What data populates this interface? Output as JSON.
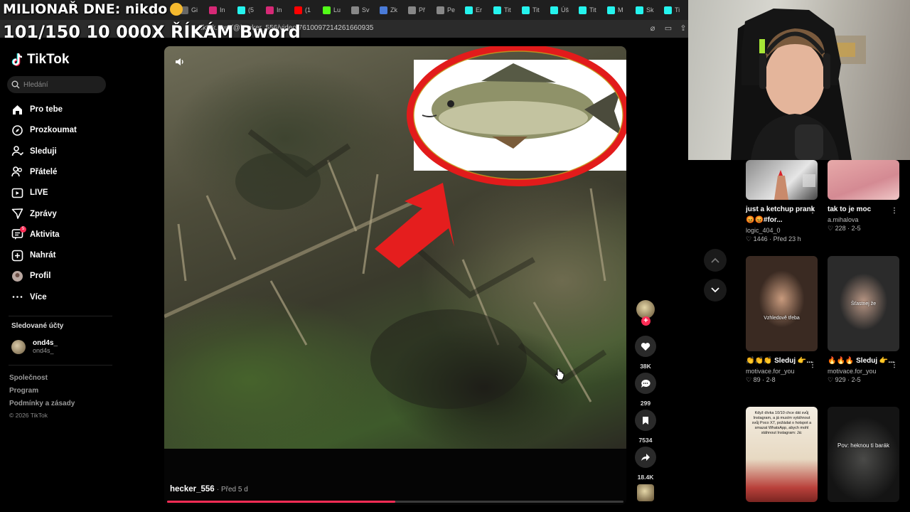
{
  "stream_overlay": {
    "line1": "MILIONAŘ DNE: nikdo",
    "line2": "101/150 10 000X ŘÍKÁM Bword"
  },
  "browser": {
    "tabs": [
      {
        "label": "Gi",
        "color": "#666666",
        "icon": "globe-icon"
      },
      {
        "label": "In",
        "color": "#d62976",
        "icon": "instagram-icon"
      },
      {
        "label": "(5",
        "color": "#25f4ee",
        "icon": "tiktok-icon"
      },
      {
        "label": "In",
        "color": "#d62976",
        "icon": "instagram-icon"
      },
      {
        "label": "(1",
        "color": "#ff0000",
        "icon": "youtube-icon"
      },
      {
        "label": "Lu",
        "color": "#53fc18",
        "icon": "kick-icon"
      },
      {
        "label": "Sv",
        "color": "#888888",
        "icon": "globe-icon"
      },
      {
        "label": "Zk",
        "color": "#4a7bd8",
        "icon": "k-icon"
      },
      {
        "label": "Př",
        "color": "#888888",
        "icon": "globe-icon"
      },
      {
        "label": "Pe",
        "color": "#888888",
        "icon": "globe-icon"
      },
      {
        "label": "Er",
        "color": "#25f4ee",
        "icon": "tiktok-icon"
      },
      {
        "label": "Tit",
        "color": "#25f4ee",
        "icon": "tiktok-icon"
      },
      {
        "label": "Tit",
        "color": "#25f4ee",
        "icon": "tiktok-icon"
      },
      {
        "label": "Úš",
        "color": "#25f4ee",
        "icon": "tiktok-icon"
      },
      {
        "label": "Tit",
        "color": "#25f4ee",
        "icon": "tiktok-icon"
      },
      {
        "label": "M",
        "color": "#25f4ee",
        "icon": "tiktok-icon"
      },
      {
        "label": "Sk",
        "color": "#25f4ee",
        "icon": "tiktok-icon"
      },
      {
        "label": "Ti",
        "color": "#25f4ee",
        "icon": "tiktok-icon"
      }
    ],
    "url": "tiktok.com/@hecker_556/video/7610097214261660935"
  },
  "sidebar": {
    "logo": "TikTok",
    "search_placeholder": "Hledání",
    "nav": [
      {
        "label": "Pro tebe",
        "icon": "home-icon"
      },
      {
        "label": "Prozkoumat",
        "icon": "compass-icon"
      },
      {
        "label": "Sleduji",
        "icon": "following-icon"
      },
      {
        "label": "Přátelé",
        "icon": "friends-icon"
      },
      {
        "label": "LIVE",
        "icon": "live-icon"
      },
      {
        "label": "Zprávy",
        "icon": "messages-icon"
      },
      {
        "label": "Aktivita",
        "icon": "activity-icon",
        "badge": "5"
      },
      {
        "label": "Nahrát",
        "icon": "upload-icon"
      },
      {
        "label": "Profil",
        "icon": "profile-icon"
      },
      {
        "label": "Více",
        "icon": "more-icon"
      }
    ],
    "followed_title": "Sledované účty",
    "followed": [
      {
        "name": "ond4s_",
        "handle": "ond4s_"
      }
    ],
    "footer": [
      "Společnost",
      "Program",
      "Podmínky a zásady"
    ],
    "copyright": "© 2026 TikTok"
  },
  "video": {
    "author": "hecker_556",
    "posted": "Před 5 d",
    "progress": 0.5
  },
  "actions": {
    "likes": "38K",
    "comments": "299",
    "saves": "7534",
    "shares": "18.4K"
  },
  "recommendations": [
    {
      "title": "just a ketchup prank😡😡#for...",
      "user": "logic_404_0",
      "likes": "1446",
      "age": "Před 23 h",
      "overlay": ""
    },
    {
      "title": "tak to je moc",
      "user": "a.mihalova",
      "likes": "228",
      "age": "2-5",
      "overlay": ""
    },
    {
      "title": "👏👏👏 Sleduj 👉...",
      "user": "motivace.for_you",
      "likes": "89",
      "age": "2-8",
      "overlay": "Vzhledově třeba"
    },
    {
      "title": "🔥🔥🔥 Sleduj 👉...",
      "user": "motivace.for_you",
      "likes": "929",
      "age": "2-5",
      "overlay": "Šťastnej že"
    },
    {
      "title": "",
      "user": "",
      "likes": "",
      "age": "",
      "overlay": "Když dívka 10/10 chce dát svůj Instagram, a já musím vytáhnout svůj Poco X7, požádat o hotspot a smazat WhatsApp, abych mohl stáhnout Instagram: Já:"
    },
    {
      "title": "",
      "user": "",
      "likes": "",
      "age": "",
      "overlay": "Pov: heknou ti barák"
    }
  ]
}
